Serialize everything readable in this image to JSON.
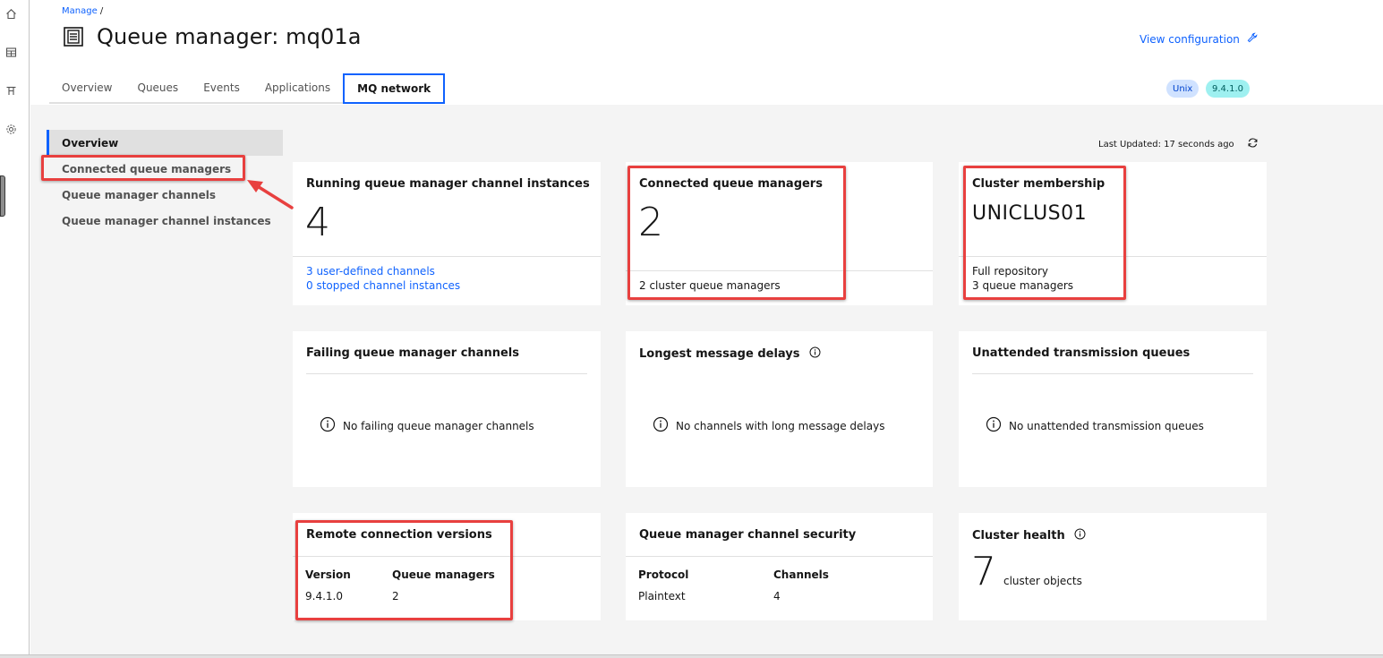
{
  "breadcrumb": {
    "link": "Manage",
    "sep": "/"
  },
  "header": {
    "title": "Queue manager: mq01a",
    "view_config": "View configuration"
  },
  "tabs": [
    {
      "label": "Overview"
    },
    {
      "label": "Queues"
    },
    {
      "label": "Events"
    },
    {
      "label": "Applications"
    },
    {
      "label": "MQ network"
    }
  ],
  "tags": {
    "platform": "Unix",
    "version": "9.4.1.0"
  },
  "sidenav": [
    {
      "label": "Overview"
    },
    {
      "label": "Connected queue managers"
    },
    {
      "label": "Queue manager channels"
    },
    {
      "label": "Queue manager channel instances"
    }
  ],
  "last_updated": "Last Updated: 17 seconds ago",
  "cards": {
    "running": {
      "title": "Running queue manager channel instances",
      "value": "4",
      "line1": "3 user-defined channels",
      "line2": "0 stopped channel instances"
    },
    "connected": {
      "title": "Connected queue managers",
      "value": "2",
      "line1": "2 cluster queue managers"
    },
    "cluster": {
      "title": "Cluster membership",
      "name": "UNICLUS01",
      "line1": "Full repository",
      "line2": "3 queue managers"
    },
    "failing": {
      "title": "Failing queue manager channels",
      "message": "No failing queue manager channels"
    },
    "delays": {
      "title": "Longest message delays",
      "message": "No channels with long message delays"
    },
    "unattended": {
      "title": "Unattended transmission queues",
      "message": "No unattended transmission queues"
    },
    "remote": {
      "title": "Remote connection versions",
      "col1": "Version",
      "col2": "Queue managers",
      "row_version": "9.4.1.0",
      "row_count": "2"
    },
    "security": {
      "title": "Queue manager channel security",
      "col1": "Protocol",
      "col2": "Channels",
      "row_protocol": "Plaintext",
      "row_count": "4"
    },
    "health": {
      "title": "Cluster health",
      "value": "7",
      "unit": "cluster objects"
    }
  },
  "colors": {
    "accent": "#0f62fe",
    "annotation": "#e8403f",
    "background": "#f4f4f4"
  },
  "icons": [
    "home-icon",
    "table-icon",
    "ruler-icon",
    "settings-icon",
    "queue-manager-icon",
    "wrench-icon",
    "refresh-icon",
    "info-icon"
  ]
}
